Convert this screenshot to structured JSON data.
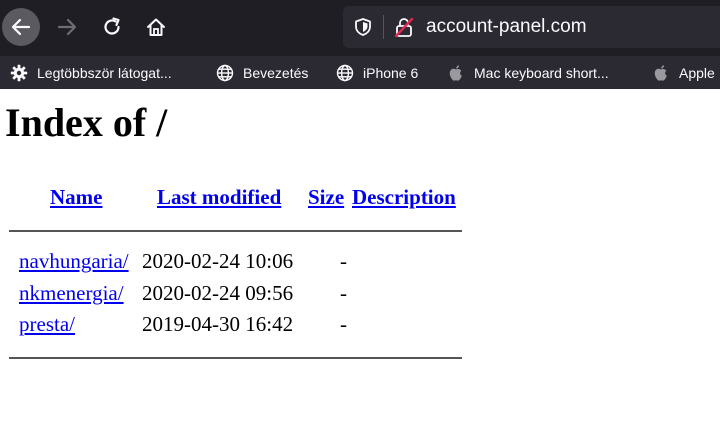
{
  "browser": {
    "url": "account-panel.com",
    "bookmarks": [
      {
        "label": "Legtöbbször látogat...",
        "icon": "gear-icon"
      },
      {
        "label": "Bevezetés",
        "icon": "globe-icon"
      },
      {
        "label": "iPhone 6",
        "icon": "globe-icon"
      },
      {
        "label": "Mac keyboard short...",
        "icon": "apple-icon"
      },
      {
        "label": "Apple",
        "icon": "apple-icon"
      }
    ]
  },
  "page": {
    "title": "Index of /",
    "columns": {
      "name": "Name",
      "last_modified": "Last modified",
      "size": "Size",
      "description": "Description"
    },
    "entries": [
      {
        "name": "navhungaria/",
        "modified": "2020-02-24 10:06",
        "size": "-"
      },
      {
        "name": "nkmenergia/",
        "modified": "2020-02-24 09:56",
        "size": "-"
      },
      {
        "name": "presta/",
        "modified": "2019-04-30 16:42",
        "size": "-"
      }
    ]
  }
}
